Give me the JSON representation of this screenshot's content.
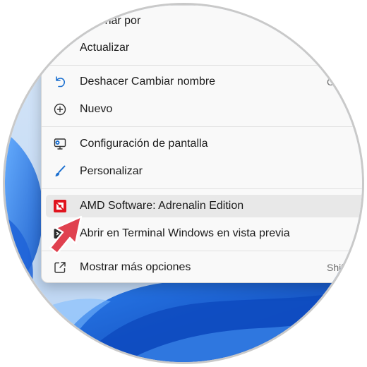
{
  "menu": {
    "items": [
      {
        "label": "Ordenar por",
        "icon": "sort-icon"
      },
      {
        "label": "Actualizar",
        "icon": "refresh-icon"
      },
      {
        "label": "Deshacer Cambiar nombre",
        "icon": "undo-icon",
        "shortcut": "C"
      },
      {
        "label": "Nuevo",
        "icon": "add-circle-icon"
      },
      {
        "label": "Configuración de pantalla",
        "icon": "display-settings-icon"
      },
      {
        "label": "Personalizar",
        "icon": "brush-icon"
      },
      {
        "label": "AMD Software: Adrenalin Edition",
        "icon": "amd-logo-icon",
        "highlighted": true
      },
      {
        "label": "Abrir en Terminal Windows en vista previa",
        "icon": "terminal-icon"
      },
      {
        "label": "Mostrar más opciones",
        "icon": "open-external-icon",
        "shortcut": "Shift"
      }
    ]
  },
  "colors": {
    "menu_background": "#f9f9f9",
    "hover_background": "#e8e8e8",
    "accent_blue": "#1a6fd0",
    "amd_red": "#e0141e",
    "pointer_red": "#e0414f",
    "wallpaper_blue": "#1f6fe0"
  },
  "overlay": {
    "pointer": "red-pointer-arrow-icon"
  }
}
